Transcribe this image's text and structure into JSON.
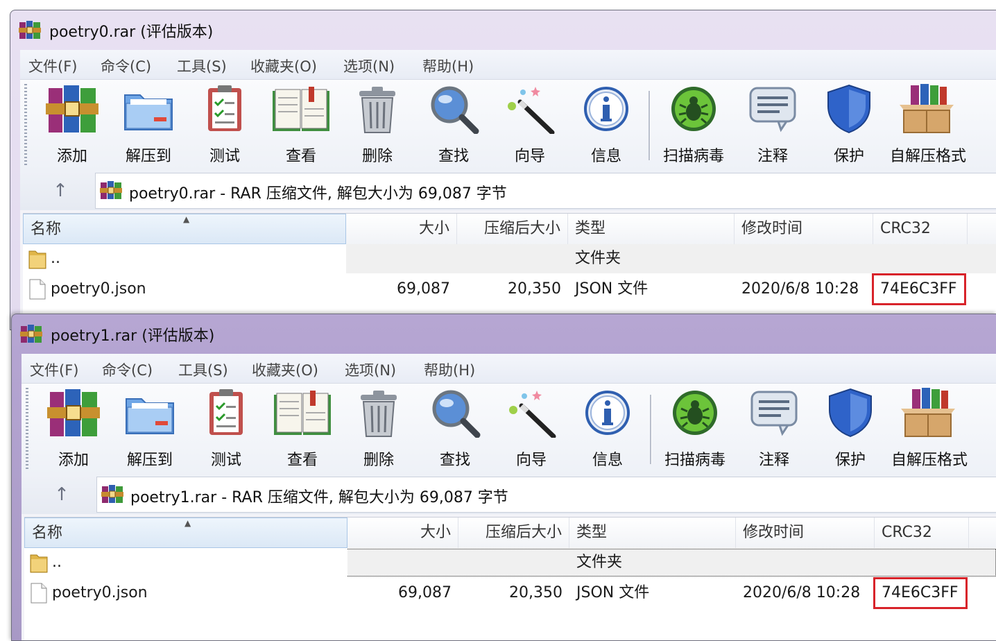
{
  "windows": [
    {
      "title": "poetry0.rar (评估版本)",
      "menu": [
        "文件(F)",
        "命令(C)",
        "工具(S)",
        "收藏夹(O)",
        "选项(N)",
        "帮助(H)"
      ],
      "toolbar": [
        "添加",
        "解压到",
        "测试",
        "查看",
        "删除",
        "查找",
        "向导",
        "信息",
        "扫描病毒",
        "注释",
        "保护",
        "自解压格式"
      ],
      "up_arrow": "↑",
      "address": "poetry0.rar - RAR 压缩文件, 解包大小为 69,087 字节",
      "columns": {
        "name": "名称",
        "size": "大小",
        "packed": "压缩后大小",
        "type": "类型",
        "modified": "修改时间",
        "crc": "CRC32"
      },
      "rows": [
        {
          "name": "..",
          "size": "",
          "packed": "",
          "type": "文件夹",
          "modified": "",
          "crc": ""
        },
        {
          "name": "poetry0.json",
          "size": "69,087",
          "packed": "20,350",
          "type": "JSON 文件",
          "modified": "2020/6/8 10:28",
          "crc": "74E6C3FF"
        }
      ]
    },
    {
      "title": "poetry1.rar (评估版本)",
      "menu": [
        "文件(F)",
        "命令(C)",
        "工具(S)",
        "收藏夹(O)",
        "选项(N)",
        "帮助(H)"
      ],
      "toolbar": [
        "添加",
        "解压到",
        "测试",
        "查看",
        "删除",
        "查找",
        "向导",
        "信息",
        "扫描病毒",
        "注释",
        "保护",
        "自解压格式"
      ],
      "up_arrow": "↑",
      "address": "poetry1.rar - RAR 压缩文件, 解包大小为 69,087 字节",
      "columns": {
        "name": "名称",
        "size": "大小",
        "packed": "压缩后大小",
        "type": "类型",
        "modified": "修改时间",
        "crc": "CRC32"
      },
      "rows": [
        {
          "name": "..",
          "size": "",
          "packed": "",
          "type": "文件夹",
          "modified": "",
          "crc": ""
        },
        {
          "name": "poetry0.json",
          "size": "69,087",
          "packed": "20,350",
          "type": "JSON 文件",
          "modified": "2020/6/8 10:28",
          "crc": "74E6C3FF"
        }
      ]
    }
  ],
  "colors": {
    "highlight": "#d8232a",
    "title_active": "#a899c6",
    "title_inactive": "#e3dbef"
  },
  "icons": [
    "winrar-icon",
    "add-icon",
    "extract-icon",
    "test-icon",
    "view-icon",
    "delete-icon",
    "find-icon",
    "wizard-icon",
    "info-icon",
    "virus-scan-icon",
    "comment-icon",
    "protect-icon",
    "sfx-icon",
    "folder-icon",
    "file-icon",
    "up-arrow-icon"
  ]
}
